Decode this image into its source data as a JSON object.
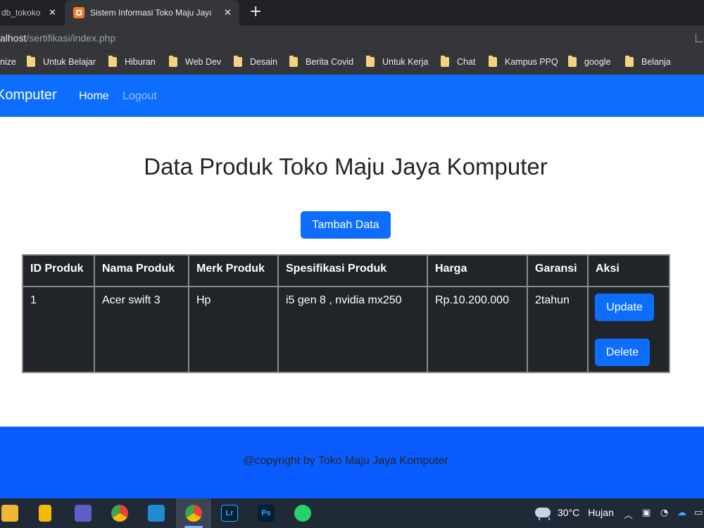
{
  "browser": {
    "tabs": [
      {
        "title": "db_tokoko"
      },
      {
        "title": "Sistem Informasi Toko Maju Jaya"
      }
    ],
    "close_glyph": "✕",
    "new_tab_glyph": "+",
    "url_host": "alhost",
    "url_path": "/sertifikasi/index.php",
    "bookmarks": [
      {
        "label": "nize",
        "folder": false
      },
      {
        "label": "Untuk Belajar",
        "folder": true
      },
      {
        "label": "Hiburan",
        "folder": true
      },
      {
        "label": "Web Dev",
        "folder": true
      },
      {
        "label": "Desain",
        "folder": true
      },
      {
        "label": "Berita Covid",
        "folder": true
      },
      {
        "label": "Untuk Kerja",
        "folder": true
      },
      {
        "label": "Chat",
        "folder": true
      },
      {
        "label": "Kampus PPQ",
        "folder": true
      },
      {
        "label": "google",
        "folder": true
      },
      {
        "label": "Belanja",
        "folder": true
      }
    ]
  },
  "navbar": {
    "brand": "Komputer",
    "home": "Home",
    "logout": "Logout"
  },
  "main": {
    "title": "Data Produk Toko Maju Jaya Komputer",
    "add_button": "Tambah Data",
    "table": {
      "headers": [
        "ID Produk",
        "Nama Produk",
        "Merk Produk",
        "Spesifikasi Produk",
        "Harga",
        "Garansi",
        "Aksi"
      ],
      "rows": [
        [
          "1",
          "Acer swift 3",
          "Hp",
          "i5 gen 8 , nvidia mx250",
          "Rp.10.200.000",
          "2tahun"
        ]
      ],
      "actions": {
        "update": "Update",
        "delete": "Delete"
      }
    }
  },
  "footer": {
    "text": "@copyright by Toko Maju Jaya Komputer"
  },
  "taskbar": {
    "apps": [
      "file-explorer-icon",
      "google-keep-icon",
      "teams-icon",
      "chrome-icon",
      "vscode-icon",
      "chrome-profile-icon",
      "lightroom-icon",
      "photoshop-icon",
      "whatsapp-icon"
    ],
    "lightroom_label": "Lr",
    "photoshop_label": "Ps",
    "temperature": "30°C",
    "weather": "Hujan"
  },
  "colors": {
    "primary": "#0d6efd",
    "table_bg": "#212529",
    "chrome_dark": "#202124"
  }
}
